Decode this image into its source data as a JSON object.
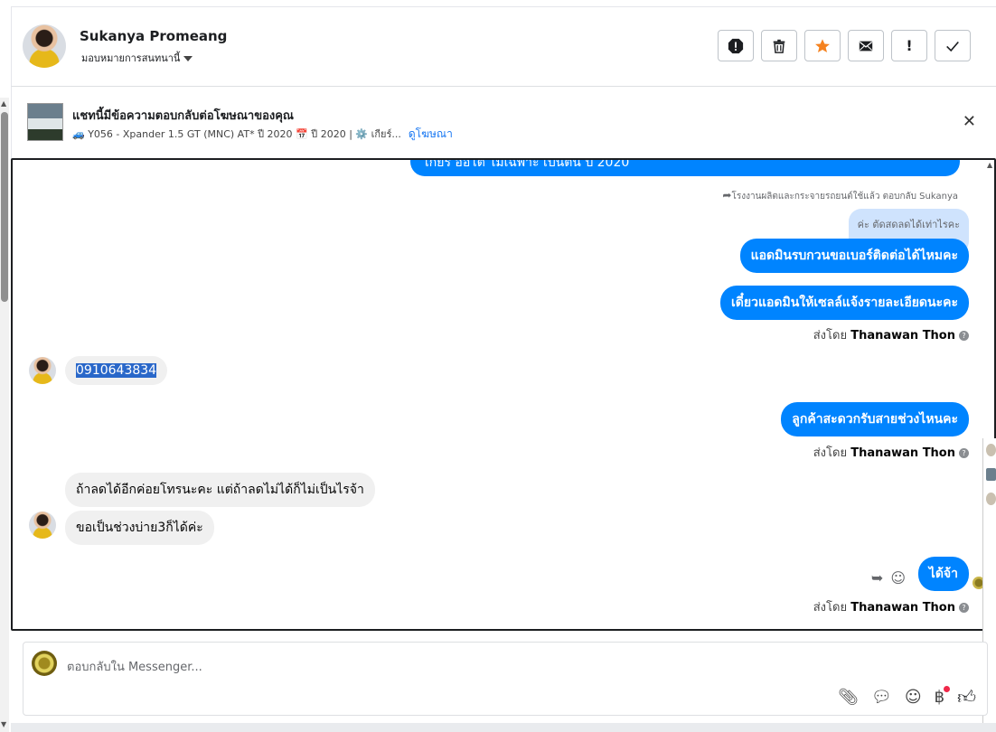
{
  "header": {
    "name": "Sukanya Promeang",
    "assign_label": "มอบหมายการสนทนานี้",
    "actions": [
      "spam-report",
      "delete",
      "star",
      "mark-unread",
      "follow-up",
      "done"
    ]
  },
  "ad": {
    "title": "แชทนี้มีข้อความตอบกลับต่อโฆษณาของคุณ",
    "subtitle": "🚙 Y056 - Xpander 1.5 GT (MNC) AT* ปี 2020 📅 ปี 2020 | ⚙️ เกียร์...",
    "link": "ดูโฆษณา"
  },
  "chat": {
    "cut_top_message": "เกียร์ ออโต้ ไม่เฉพาะ เป็นต้น ปี 2020",
    "reply_meta": "โรงงานผลิตและกระจายรถยนต์ใช้แล้ว ตอบกลับ Sukanya",
    "reply_quote": "ค่ะ ตัดสดลดได้เท่าไรคะ",
    "messages": [
      {
        "dir": "out",
        "text": "แอดมินรบกวนขอเบอร์ติดต่อได้ไหมคะ"
      },
      {
        "dir": "out",
        "text": "เดี๋ยวแอดมินให้เซลล์แจ้งรายละเอียดนะคะ"
      },
      {
        "dir": "in",
        "text": "0910643834"
      },
      {
        "dir": "out",
        "text": "ลูกค้าสะดวกรับสายช่วงไหนคะ"
      },
      {
        "dir": "in",
        "text": "ถ้าลดได้อีกค่อยโทรนะคะ แต่ถ้าลดไม่ได้ก็ไม่เป็นไรจ้า"
      },
      {
        "dir": "in",
        "text": "ขอเป็นช่วงบ่าย3ก็ได้ค่ะ"
      },
      {
        "dir": "out",
        "text": "ได้จ้า"
      }
    ],
    "sent_by_prefix": "ส่งโดย",
    "sent_by_name": "Thanawan Thon"
  },
  "composer": {
    "placeholder": "ตอบกลับใน Messenger..."
  }
}
